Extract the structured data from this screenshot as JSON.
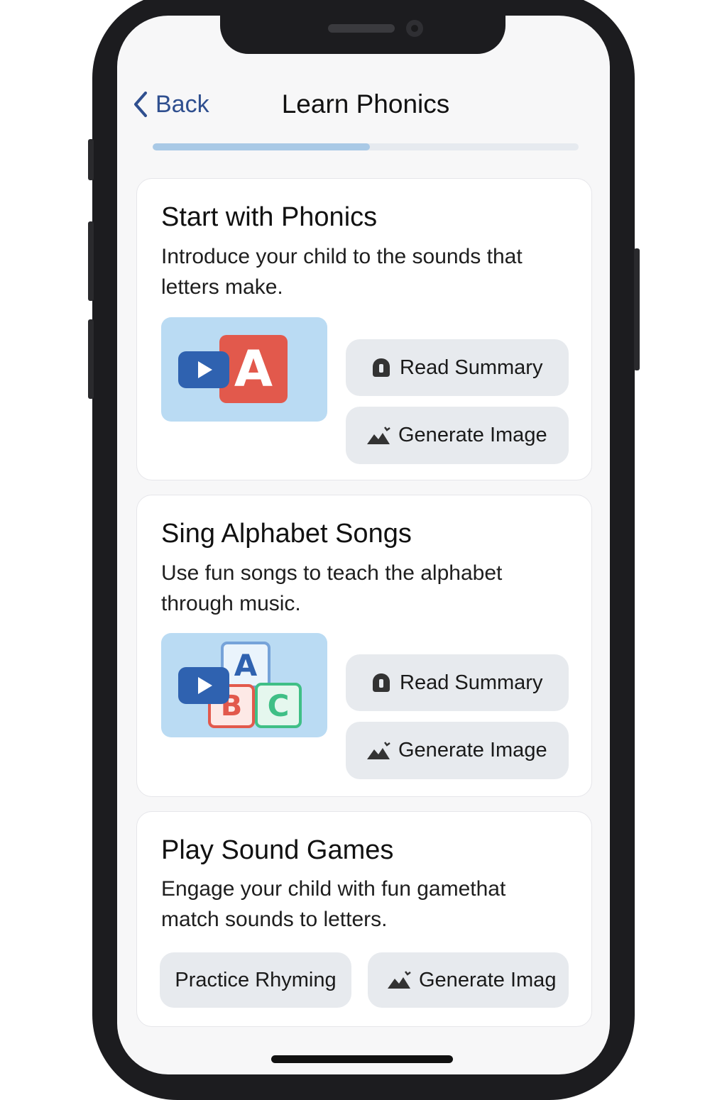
{
  "header": {
    "back_label": "Back",
    "title": "Learn Phonics",
    "progress_fraction": 0.51
  },
  "cards": [
    {
      "title": "Start with Phonics",
      "description": "Introduce your child to the sounds that letters make.",
      "thumbnail_letter": "A",
      "thumbnail_icon": "play-icon",
      "buttons": [
        {
          "label": "Read Summary",
          "icon": "audio-icon"
        },
        {
          "label": "Generate Image",
          "icon": "image-icon"
        }
      ]
    },
    {
      "title": "Sing Alphabet Songs",
      "description": "Use fun songs to teach the alphabet through music.",
      "thumbnail_letters": [
        "A",
        "B",
        "C"
      ],
      "thumbnail_icon": "play-icon",
      "buttons": [
        {
          "label": "Read Summary",
          "icon": "audio-icon"
        },
        {
          "label": "Generate Image",
          "icon": "image-icon"
        }
      ]
    },
    {
      "title": "Play Sound Games",
      "description": "Engage your child with fun gamethat match sounds to letters.",
      "buttons": [
        {
          "label": "Practice Rhyming"
        },
        {
          "label": "Generate Imag",
          "icon": "image-icon"
        }
      ]
    }
  ],
  "colors": {
    "accent_blue": "#2f62b0",
    "letter_red": "#e2594c",
    "letter_green": "#3fbf86",
    "thumb_bg": "#badbf3",
    "button_bg": "#e7eaee"
  }
}
